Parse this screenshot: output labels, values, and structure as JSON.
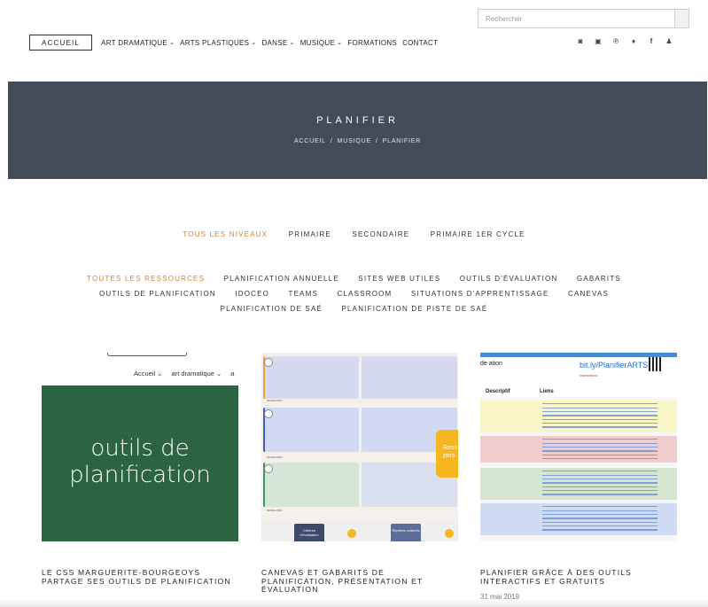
{
  "search": {
    "placeholder": "Rechercher"
  },
  "nav": {
    "items": [
      {
        "label": "ACCUEIL",
        "dropdown": false,
        "active": true
      },
      {
        "label": "ART DRAMATIQUE",
        "dropdown": true
      },
      {
        "label": "ARTS PLASTIQUES",
        "dropdown": true
      },
      {
        "label": "DANSE",
        "dropdown": true
      },
      {
        "label": "MUSIQUE",
        "dropdown": true
      },
      {
        "label": "FORMATIONS",
        "dropdown": false
      },
      {
        "label": "CONTACT",
        "dropdown": false
      }
    ],
    "chevron": "⌄"
  },
  "social": [
    "instagram-icon",
    "youtube-icon",
    "pinterest-icon",
    "twitter-icon",
    "facebook-icon",
    "user-icon"
  ],
  "hero": {
    "title": "PLANIFIER",
    "breadcrumb": [
      "ACCUEIL",
      "MUSIQUE",
      "PLANIFIER"
    ],
    "breadcrumb_sep": "/"
  },
  "levels": [
    "TOUS LES NIVEAUX",
    "PRIMAIRE",
    "SECONDAIRE",
    "PRIMAIRE 1ER CYCLE"
  ],
  "resources": [
    "TOUTES LES RESSOURCES",
    "PLANIFICATION ANNUELLE",
    "SITES WEB UTILES",
    "OUTILS D'ÉVALUATION",
    "GABARITS",
    "OUTILS DE PLANIFICATION",
    "IDOCEO",
    "TEAMS",
    "CLASSROOM",
    "SITUATIONS D'APPRENTISSAGE",
    "CANEVAS",
    "PLANIFICATION DE SAÉ",
    "PLANIFICATION DE PISTE DE SAÉ"
  ],
  "cards": [
    {
      "title": "LE CSS MARGUERITE-BOURGEOYS PARTAGE SES OUTILS DE PLANIFICATION",
      "thumb": {
        "menu": [
          "Accueil ⌄",
          "art dramatique ⌄",
          "a"
        ],
        "text_line1": "outils de",
        "text_line2": "planification"
      }
    },
    {
      "title": "CANEVAS ET GABARITS DE PLANIFICATION, PRÉSENTATION ET ÉVALUATION",
      "thumb": {
        "row_label": "MODALITÉS :",
        "bubble": "Ress pers",
        "btn1": "Critères d'évaluation",
        "btn2": "Repères culturels"
      }
    },
    {
      "title": "PLANIFIER GRÂCE À DES OUTILS INTERACTIFS ET GRATUITS",
      "date": "31 mai 2019",
      "thumb": {
        "link": "bit.ly/PlanifierARTS",
        "col1": "Descriptif",
        "col2": "Liens",
        "heading": "Instructions",
        "left_header": "de ation"
      }
    }
  ],
  "colors": {
    "hero_bg": "#444b59",
    "accent": "#d1833a",
    "green_board": "#2b6340"
  }
}
